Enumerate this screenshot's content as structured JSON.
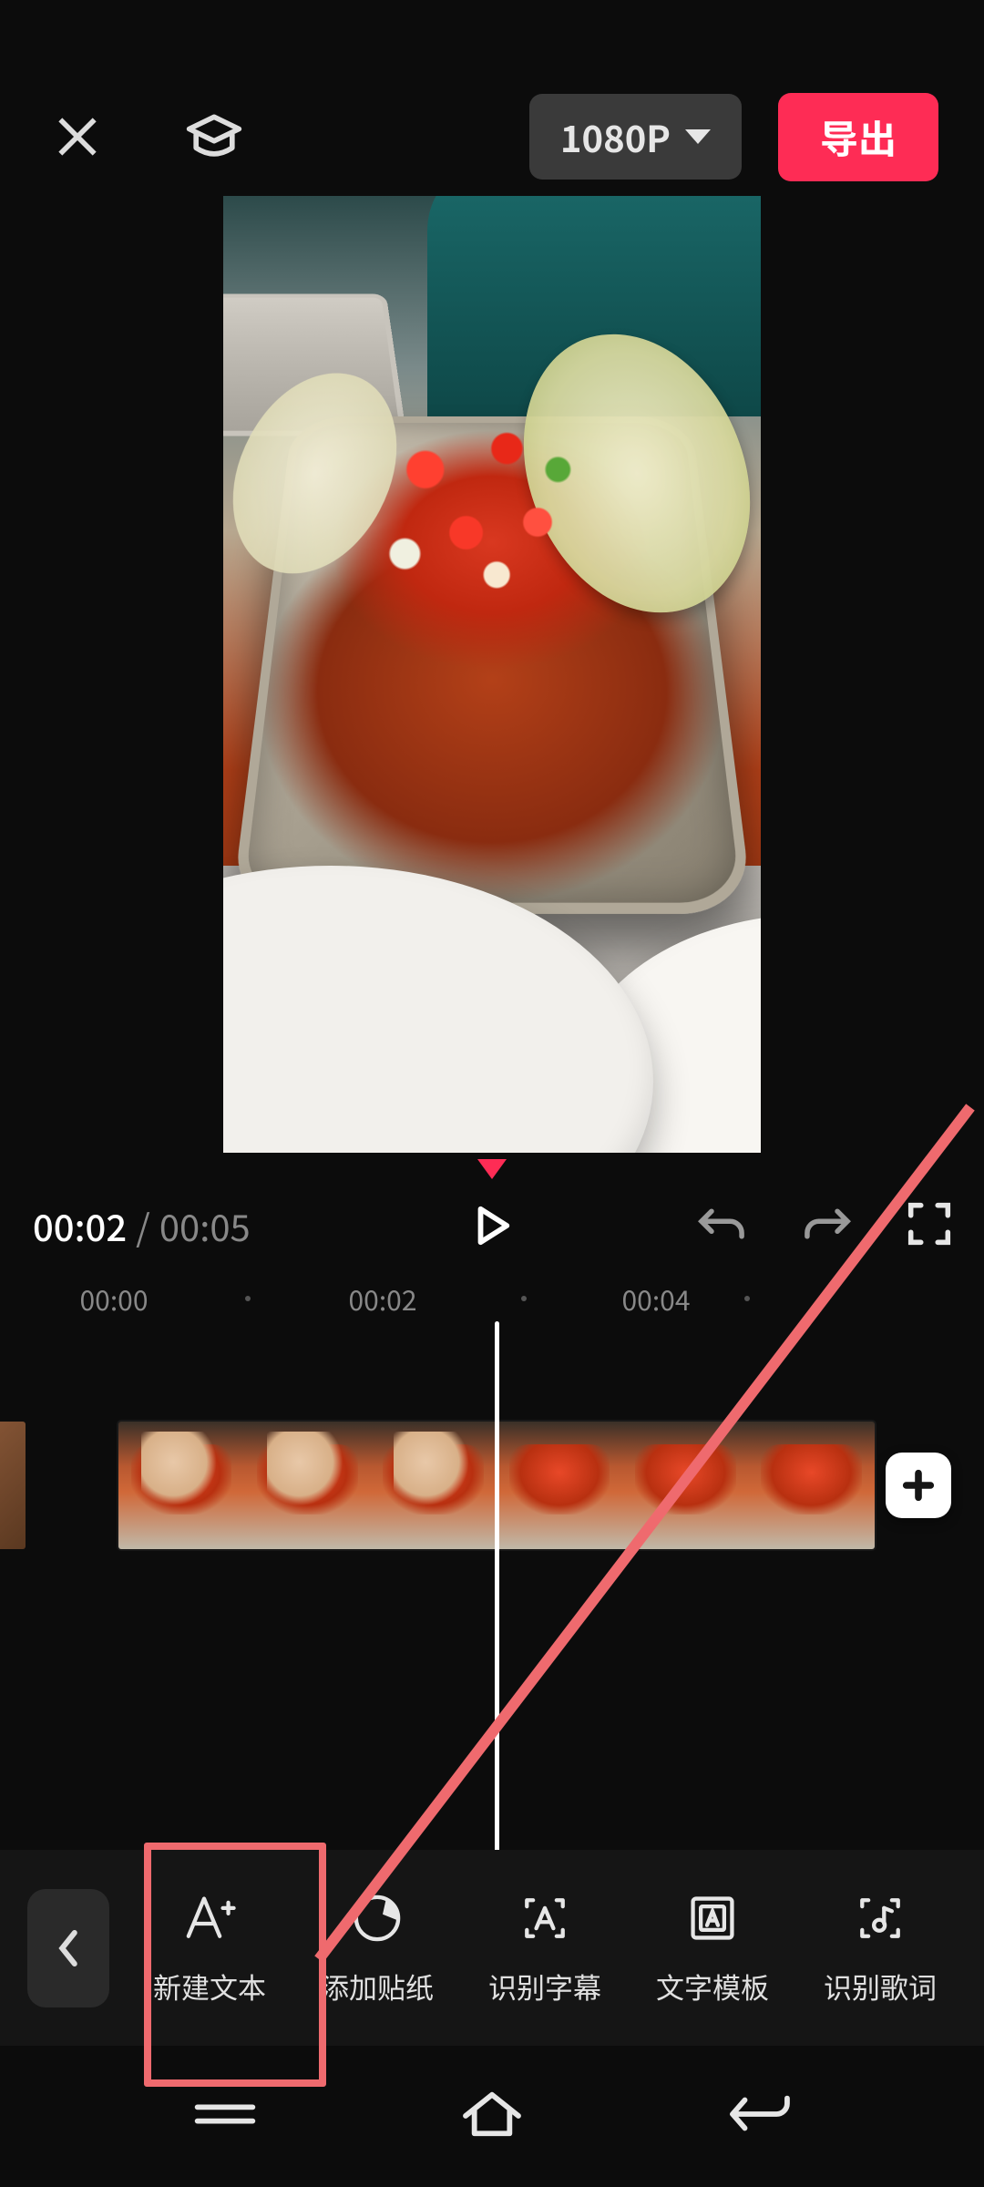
{
  "header": {
    "resolution_label": "1080P",
    "export_label": "导出"
  },
  "playback": {
    "current_time": "00:02",
    "separator": "/",
    "duration": "00:05"
  },
  "ruler": {
    "ticks": [
      "00:00",
      "00:02",
      "00:04"
    ]
  },
  "tools": {
    "items": [
      {
        "id": "new-text",
        "label": "新建文本"
      },
      {
        "id": "add-sticker",
        "label": "添加贴纸"
      },
      {
        "id": "auto-captions",
        "label": "识别字幕"
      },
      {
        "id": "text-templates",
        "label": "文字模板"
      },
      {
        "id": "recognize-lyrics",
        "label": "识别歌词"
      }
    ]
  },
  "add_clip_label": "+",
  "annotation": {
    "highlighted_tool_index": 0
  }
}
